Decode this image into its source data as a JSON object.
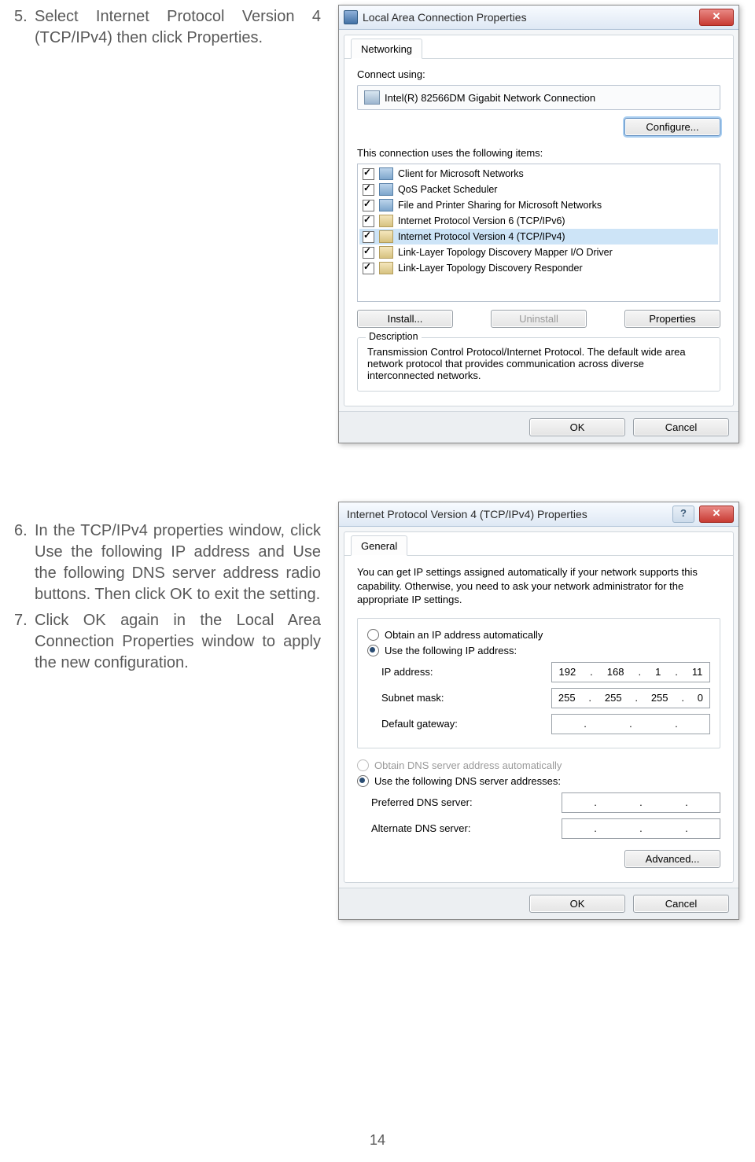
{
  "steps": {
    "s5": {
      "num": "5.",
      "text": "Select Internet Protocol Version 4 (TCP/IPv4) then click Properties."
    },
    "s6": {
      "num": "6.",
      "text": "In the TCP/IPv4 properties window, click Use the following IP address and Use the following DNS server address radio buttons. Then click OK to exit the setting."
    },
    "s7": {
      "num": "7.",
      "text": "Click OK again in the Local Area Connection Properties window to apply the new configuration."
    }
  },
  "dlg1": {
    "title": "Local Area Connection Properties",
    "tab": "Networking",
    "connect_using": "Connect using:",
    "adapter": "Intel(R) 82566DM Gigabit Network Connection",
    "configure": "Configure...",
    "items_label": "This connection uses the following items:",
    "items": [
      "Client for Microsoft Networks",
      "QoS Packet Scheduler",
      "File and Printer Sharing for Microsoft Networks",
      "Internet Protocol Version 6 (TCP/IPv6)",
      "Internet Protocol Version 4 (TCP/IPv4)",
      "Link-Layer Topology Discovery Mapper I/O Driver",
      "Link-Layer Topology Discovery Responder"
    ],
    "install": "Install...",
    "uninstall": "Uninstall",
    "properties": "Properties",
    "desc_label": "Description",
    "desc": "Transmission Control Protocol/Internet Protocol. The default wide area network protocol that provides communication across diverse interconnected networks.",
    "ok": "OK",
    "cancel": "Cancel"
  },
  "dlg2": {
    "title": "Internet Protocol Version 4 (TCP/IPv4) Properties",
    "tab": "General",
    "info": "You can get IP settings assigned automatically if your network supports this capability. Otherwise, you need to ask your network administrator for the appropriate IP settings.",
    "obtain_ip": "Obtain an IP address automatically",
    "use_ip": "Use the following IP address:",
    "ip_label": "IP address:",
    "ip": [
      "192",
      "168",
      "1",
      "11"
    ],
    "subnet_label": "Subnet mask:",
    "subnet": [
      "255",
      "255",
      "255",
      "0"
    ],
    "gw_label": "Default gateway:",
    "gw": [
      "",
      "",
      "",
      ""
    ],
    "obtain_dns": "Obtain DNS server address automatically",
    "use_dns": "Use the following DNS server addresses:",
    "pdns_label": "Preferred DNS server:",
    "pdns": [
      "",
      "",
      "",
      ""
    ],
    "adns_label": "Alternate DNS server:",
    "adns": [
      "",
      "",
      "",
      ""
    ],
    "advanced": "Advanced...",
    "ok": "OK",
    "cancel": "Cancel"
  },
  "page_number": "14"
}
